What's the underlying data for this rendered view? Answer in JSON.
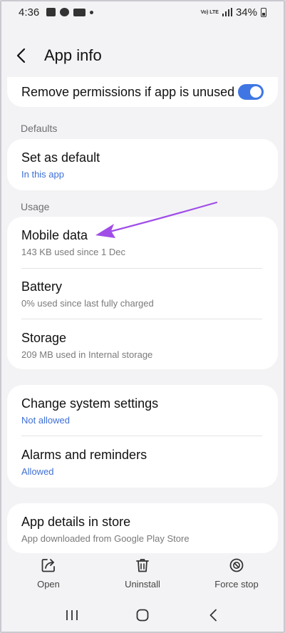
{
  "status_bar": {
    "time": "4:36",
    "battery": "34%",
    "network_label": "Vo) LTE"
  },
  "header": {
    "title": "App info"
  },
  "permissions": {
    "label": "Remove permissions if app is unused",
    "toggle_on": true
  },
  "sections": {
    "defaults": "Defaults",
    "usage": "Usage"
  },
  "defaults_card": {
    "title": "Set as default",
    "subtitle": "In this app"
  },
  "usage_card": {
    "mobile_data_title": "Mobile data",
    "mobile_data_sub": "143 KB used since 1 Dec",
    "battery_title": "Battery",
    "battery_sub": "0% used since last fully charged",
    "storage_title": "Storage",
    "storage_sub": "209 MB used in Internal storage"
  },
  "system_card": {
    "change_settings_title": "Change system settings",
    "change_settings_sub": "Not allowed",
    "alarms_title": "Alarms and reminders",
    "alarms_sub": "Allowed"
  },
  "store_card": {
    "title": "App details in store",
    "subtitle": "App downloaded from Google Play Store"
  },
  "actions": {
    "open": "Open",
    "uninstall": "Uninstall",
    "force_stop": "Force stop"
  },
  "colors": {
    "accent": "#3f76e4",
    "link_blue": "#3d6fd6",
    "annotation": "#a04de8"
  }
}
